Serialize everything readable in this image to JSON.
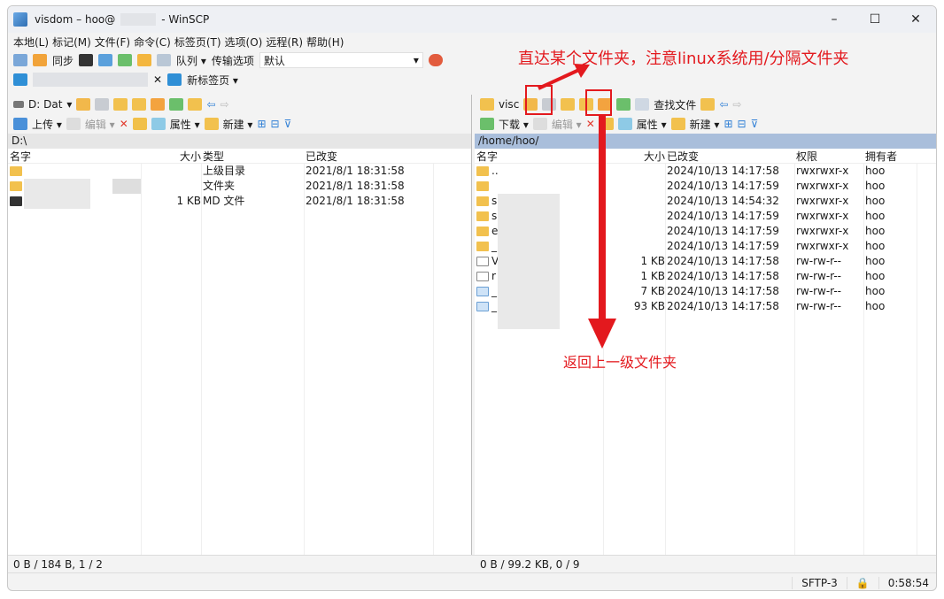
{
  "window": {
    "title_prefix": "visdom – hoo@",
    "title_suffix": "- WinSCP",
    "controls": [
      "–",
      "☐",
      "✕"
    ]
  },
  "menu": [
    "本地(L)",
    "标记(M)",
    "文件(F)",
    "命令(C)",
    "标签页(T)",
    "选项(O)",
    "远程(R)",
    "帮助(H)"
  ],
  "toolbar": {
    "sync": "同步",
    "queue": "队列 ▾",
    "transfer_options": "传输选项",
    "transfer_value": "默认"
  },
  "tabs": {
    "new_tab": "新标签页 ▾"
  },
  "left": {
    "drive": "D: Dat",
    "upload": "上传 ▾",
    "edit": "编辑 ▾",
    "properties": "属性 ▾",
    "new": "新建 ▾",
    "path": "D:\\",
    "columns": [
      "名字",
      "大小",
      "类型",
      "已改变"
    ],
    "rows": [
      {
        "name": "",
        "size": "",
        "type": "上级目录",
        "changed": "2021/8/1 18:31:58"
      },
      {
        "name": "",
        "size": "",
        "type": "文件夹",
        "changed": "2021/8/1 18:31:58"
      },
      {
        "name": "",
        "size": "1 KB",
        "type": "MD 文件",
        "changed": "2021/8/1 18:31:58"
      }
    ],
    "status": "0 B / 184 B,  1 / 2"
  },
  "right": {
    "folder": "visc",
    "find": "查找文件",
    "download": "下载 ▾",
    "edit": "编辑 ▾",
    "properties": "属性 ▾",
    "new": "新建 ▾",
    "path": "/home/hoo/",
    "columns": [
      "名字",
      "大小",
      "已改变",
      "权限",
      "拥有者"
    ],
    "rows": [
      {
        "name": "..",
        "size": "",
        "changed": "2024/10/13 14:17:58",
        "perm": "rwxrwxr-x",
        "owner": "hoo"
      },
      {
        "name": "",
        "size": "",
        "changed": "2024/10/13 14:17:59",
        "perm": "rwxrwxr-x",
        "owner": "hoo"
      },
      {
        "name": "s",
        "size": "",
        "changed": "2024/10/13 14:54:32",
        "perm": "rwxrwxr-x",
        "owner": "hoo"
      },
      {
        "name": "s",
        "size": "",
        "changed": "2024/10/13 14:17:59",
        "perm": "rwxrwxr-x",
        "owner": "hoo"
      },
      {
        "name": "e",
        "size": "",
        "changed": "2024/10/13 14:17:59",
        "perm": "rwxrwxr-x",
        "owner": "hoo"
      },
      {
        "name": "_",
        "size": "",
        "changed": "2024/10/13 14:17:59",
        "perm": "rwxrwxr-x",
        "owner": "hoo"
      },
      {
        "name": "V",
        "size": "1 KB",
        "changed": "2024/10/13 14:17:58",
        "perm": "rw-rw-r--",
        "owner": "hoo"
      },
      {
        "name": "r",
        "size": "1 KB",
        "changed": "2024/10/13 14:17:58",
        "perm": "rw-rw-r--",
        "owner": "hoo"
      },
      {
        "name": "_",
        "size": "7 KB",
        "changed": "2024/10/13 14:17:58",
        "perm": "rw-rw-r--",
        "owner": "hoo"
      },
      {
        "name": "_",
        "size": "93 KB",
        "changed": "2024/10/13 14:17:58",
        "perm": "rw-rw-r--",
        "owner": "hoo"
      }
    ],
    "status": "0 B / 99.2 KB,  0 / 9"
  },
  "bottom": {
    "protocol": "SFTP-3",
    "time": "0:58:54"
  },
  "annotations": {
    "top": "直达某个文件夹，注意linux系统用/分隔文件夹",
    "bottom": "返回上一级文件夹",
    "color": "#e3191e"
  }
}
